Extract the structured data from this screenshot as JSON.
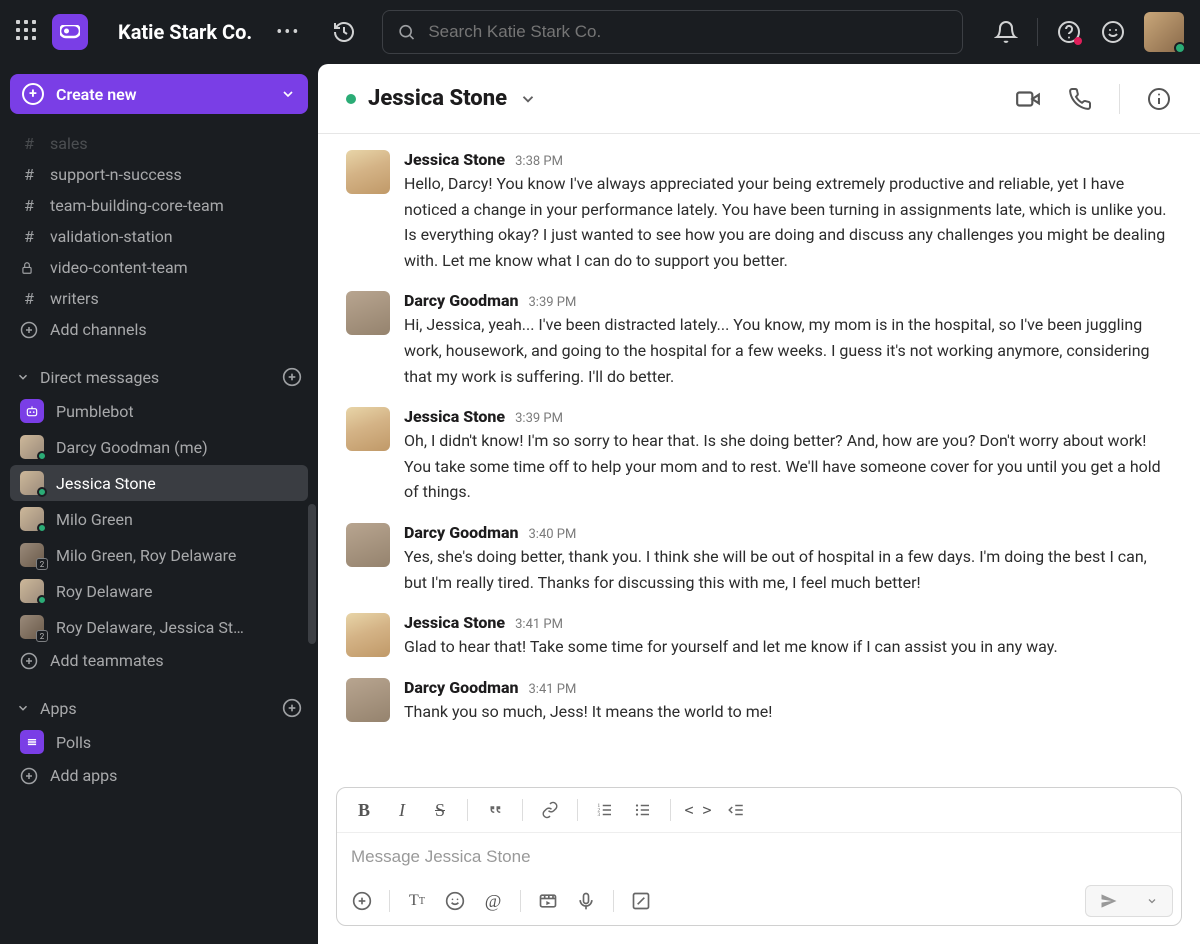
{
  "topbar": {
    "workspace_name": "Katie Stark Co.",
    "search_placeholder": "Search Katie Stark Co."
  },
  "sidebar": {
    "create_label": "Create new",
    "channels_cutoff": "sales",
    "channels": [
      {
        "name": "support-n-success",
        "type": "hash"
      },
      {
        "name": "team-building-core-team",
        "type": "hash"
      },
      {
        "name": "validation-station",
        "type": "hash"
      },
      {
        "name": "video-content-team",
        "type": "lock"
      },
      {
        "name": "writers",
        "type": "hash"
      }
    ],
    "add_channels_label": "Add channels",
    "dm_header": "Direct messages",
    "dms": [
      {
        "name": "Pumblebot",
        "kind": "bot"
      },
      {
        "name": "Darcy Goodman (me)",
        "kind": "user",
        "presence": "active"
      },
      {
        "name": "Jessica Stone",
        "kind": "user",
        "presence": "active",
        "selected": true
      },
      {
        "name": "Milo Green",
        "kind": "user",
        "presence": "active"
      },
      {
        "name": "Milo Green, Roy Delaware",
        "kind": "group",
        "count": 2
      },
      {
        "name": "Roy Delaware",
        "kind": "user",
        "presence": "active"
      },
      {
        "name": "Roy Delaware, Jessica St…",
        "kind": "group",
        "count": 2
      }
    ],
    "add_teammates_label": "Add teammates",
    "apps_header": "Apps",
    "apps": [
      {
        "name": "Polls"
      }
    ],
    "add_apps_label": "Add apps"
  },
  "chat": {
    "title": "Jessica Stone",
    "composer_placeholder": "Message Jessica Stone",
    "messages": [
      {
        "author": "Jessica Stone",
        "avatar": "jessica",
        "time": "3:38 PM",
        "text": "Hello, Darcy! You know I've always appreciated your being extremely productive and reliable, yet I have noticed a change in your performance lately. You have been turning in assignments late, which is unlike you. Is everything okay? I just wanted to see how you are doing and discuss any challenges you might be dealing with. Let me know what I can do to support you better."
      },
      {
        "author": "Darcy Goodman",
        "avatar": "darcy",
        "time": "3:39 PM",
        "text": "Hi, Jessica, yeah... I've been distracted lately... You know, my mom is in the hospital, so I've been juggling work, housework, and going to the hospital for a few weeks. I guess it's not working anymore, considering that my work is suffering. I'll do better."
      },
      {
        "author": "Jessica Stone",
        "avatar": "jessica",
        "time": "3:39 PM",
        "text": "Oh, I didn't know! I'm so sorry to hear that. Is she doing better? And, how are you? Don't worry about work! You take some time off to help your mom and to rest. We'll have someone cover for you until you get a hold of things."
      },
      {
        "author": "Darcy Goodman",
        "avatar": "darcy",
        "time": "3:40 PM",
        "text": "Yes, she's doing better, thank you. I think she will be out of hospital in a few days. I'm doing the best I can, but I'm really tired. Thanks for discussing this with me, I feel much better!"
      },
      {
        "author": "Jessica Stone",
        "avatar": "jessica",
        "time": "3:41 PM",
        "text": "Glad to hear that! Take some time for yourself and let me know if I can assist you in any way."
      },
      {
        "author": "Darcy Goodman",
        "avatar": "darcy",
        "time": "3:41 PM",
        "text": "Thank you so much, Jess! It means the world to me!"
      }
    ]
  }
}
